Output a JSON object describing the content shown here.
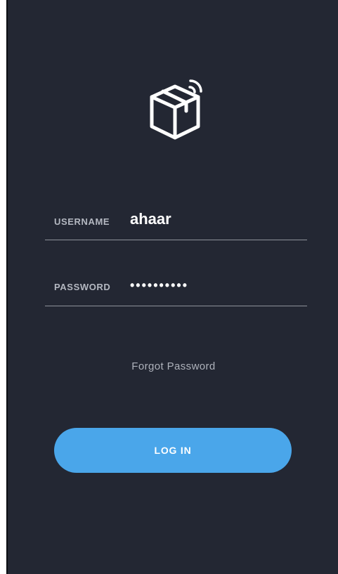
{
  "logo": {
    "icon": "package-wifi-icon"
  },
  "username": {
    "label": "USERNAME",
    "value": "ahaar"
  },
  "password": {
    "label": "PASSWORD",
    "value": "••••••••••"
  },
  "forgot": {
    "label": "Forgot Password"
  },
  "login": {
    "label": "LOG IN"
  },
  "colors": {
    "background": "#232733",
    "accent": "#4aa6ea",
    "label": "#b4b8c1",
    "text": "#ffffff"
  }
}
